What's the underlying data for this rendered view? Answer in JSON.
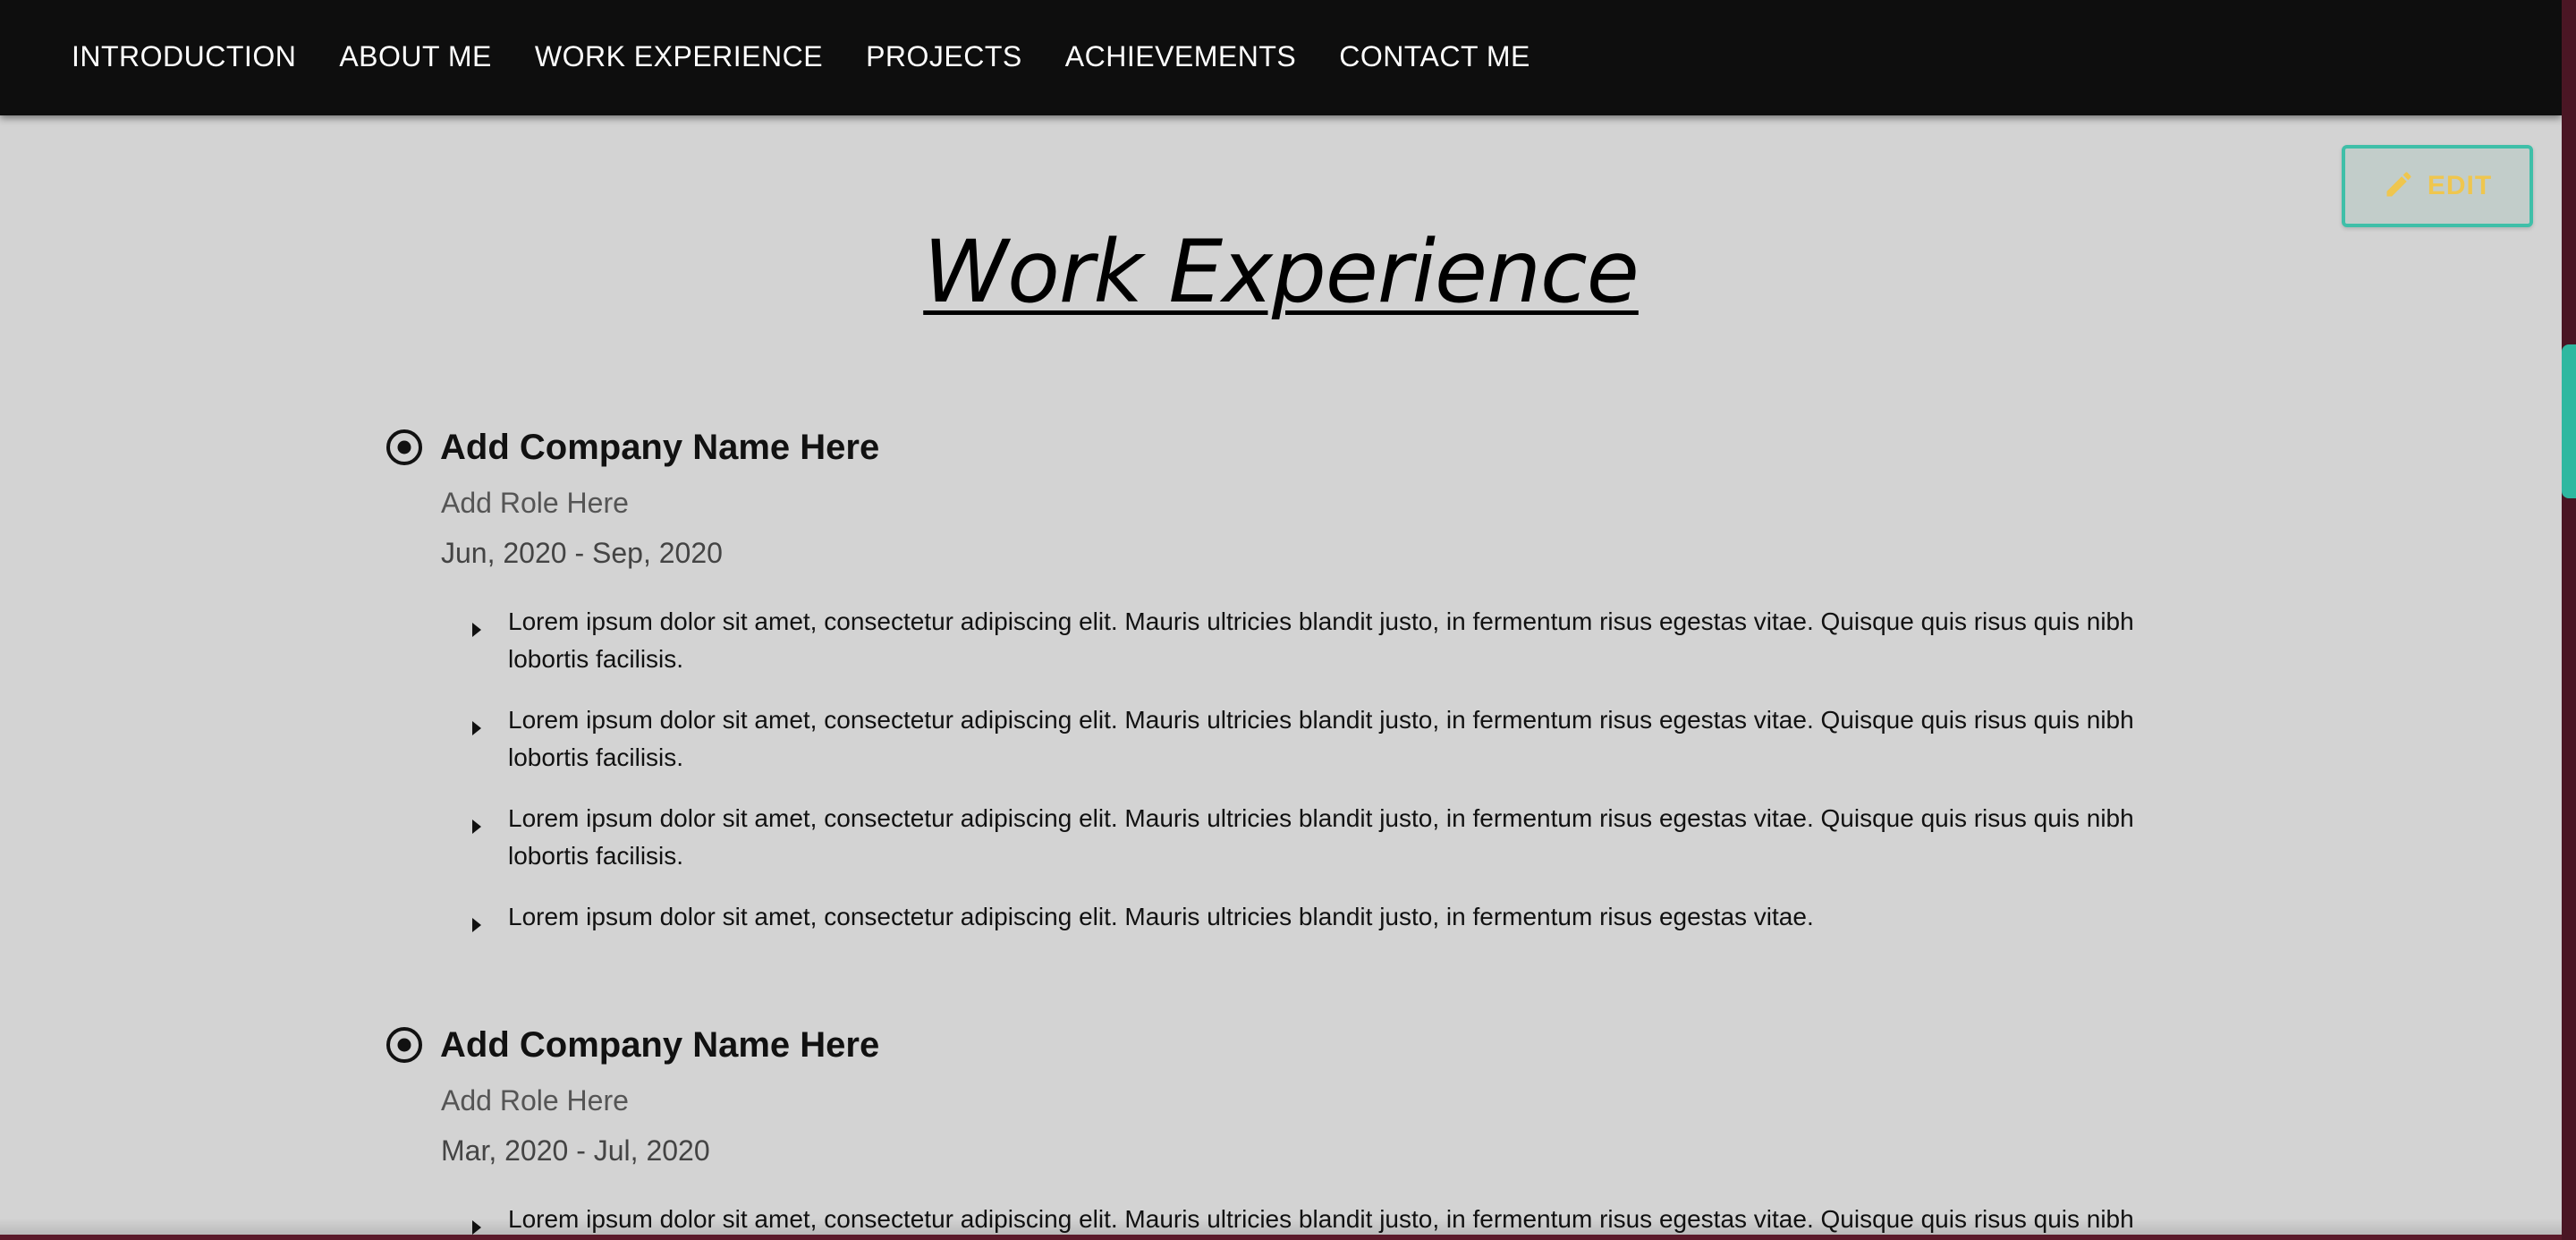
{
  "nav": {
    "items": [
      {
        "label": "INTRODUCTION"
      },
      {
        "label": "ABOUT ME"
      },
      {
        "label": "WORK EXPERIENCE"
      },
      {
        "label": "PROJECTS"
      },
      {
        "label": "ACHIEVEMENTS"
      },
      {
        "label": "CONTACT ME"
      }
    ]
  },
  "edit_button": {
    "label": "EDIT",
    "icon": "pencil-icon",
    "text_color": "#efc64e",
    "border_color": "#3fbfa8"
  },
  "section": {
    "title": "Work Experience"
  },
  "jobs": [
    {
      "company": "Add Company Name Here",
      "role": "Add Role Here",
      "dates": "Jun, 2020 - Sep, 2020",
      "bullets": [
        "Lorem ipsum dolor sit amet, consectetur adipiscing elit. Mauris ultricies blandit justo, in fermentum risus egestas vitae. Quisque quis risus quis nibh lobortis facilisis.",
        "Lorem ipsum dolor sit amet, consectetur adipiscing elit. Mauris ultricies blandit justo, in fermentum risus egestas vitae. Quisque quis risus quis nibh lobortis facilisis.",
        "Lorem ipsum dolor sit amet, consectetur adipiscing elit. Mauris ultricies blandit justo, in fermentum risus egestas vitae. Quisque quis risus quis nibh lobortis facilisis.",
        "Lorem ipsum dolor sit amet, consectetur adipiscing elit. Mauris ultricies blandit justo, in fermentum risus egestas vitae."
      ]
    },
    {
      "company": "Add Company Name Here",
      "role": "Add Role Here",
      "dates": "Mar, 2020 - Jul, 2020",
      "bullets": [
        "Lorem ipsum dolor sit amet, consectetur adipiscing elit. Mauris ultricies blandit justo, in fermentum risus egestas vitae. Quisque quis risus quis nibh"
      ]
    }
  ],
  "colors": {
    "nav_background": "#0e0e0e",
    "page_background": "#d3d3d3",
    "accent": "#2fb8a0"
  }
}
